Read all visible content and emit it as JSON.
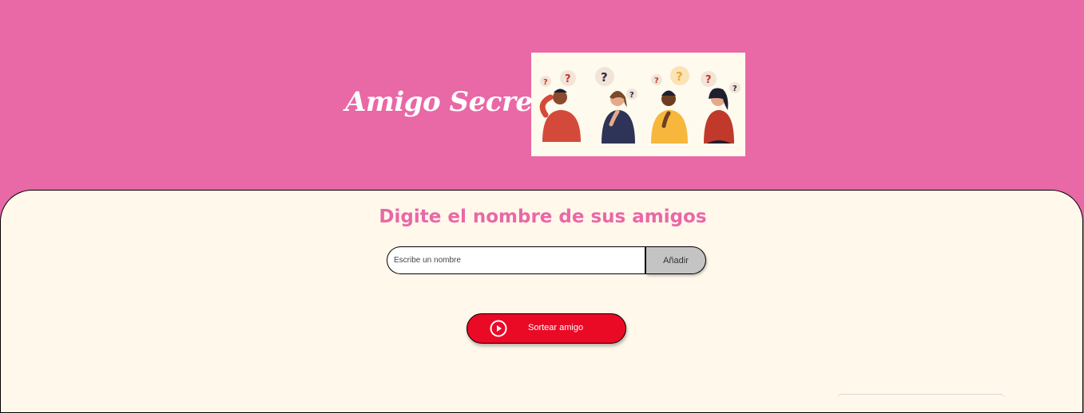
{
  "header": {
    "title": "Amigo Secreto",
    "illustration_icon": "people-thinking-illustration",
    "background_color": "#e968a6"
  },
  "main": {
    "subtitle": "Digite el nombre de sus amigos",
    "name_input": {
      "placeholder": "Escribe un nombre",
      "value": ""
    },
    "add_button_label": "Añadir",
    "draw_button": {
      "label": "Sortear amigo",
      "icon": "play-circle-icon",
      "color": "#ea0a25"
    },
    "background_color": "#fff8eb",
    "accent_color": "#e968a6"
  }
}
